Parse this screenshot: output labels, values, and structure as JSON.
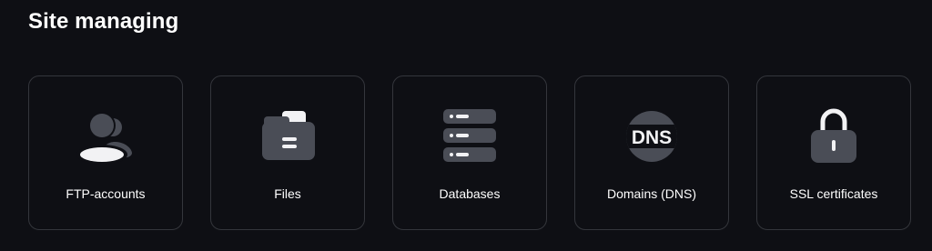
{
  "section": {
    "title": "Site managing"
  },
  "tiles": [
    {
      "label": "FTP-accounts",
      "icon": "ftp-users-icon"
    },
    {
      "label": "Files",
      "icon": "folder-icon"
    },
    {
      "label": "Databases",
      "icon": "database-icon"
    },
    {
      "label": "Domains (DNS)",
      "icon": "dns-globe-icon",
      "icon_text": "DNS"
    },
    {
      "label": "SSL certificates",
      "icon": "padlock-icon"
    }
  ],
  "colors": {
    "background": "#0e0f14",
    "tile_border": "#34363c",
    "icon_dark": "#4a4d56",
    "icon_light": "#f2f2f4",
    "text": "#ffffff"
  }
}
